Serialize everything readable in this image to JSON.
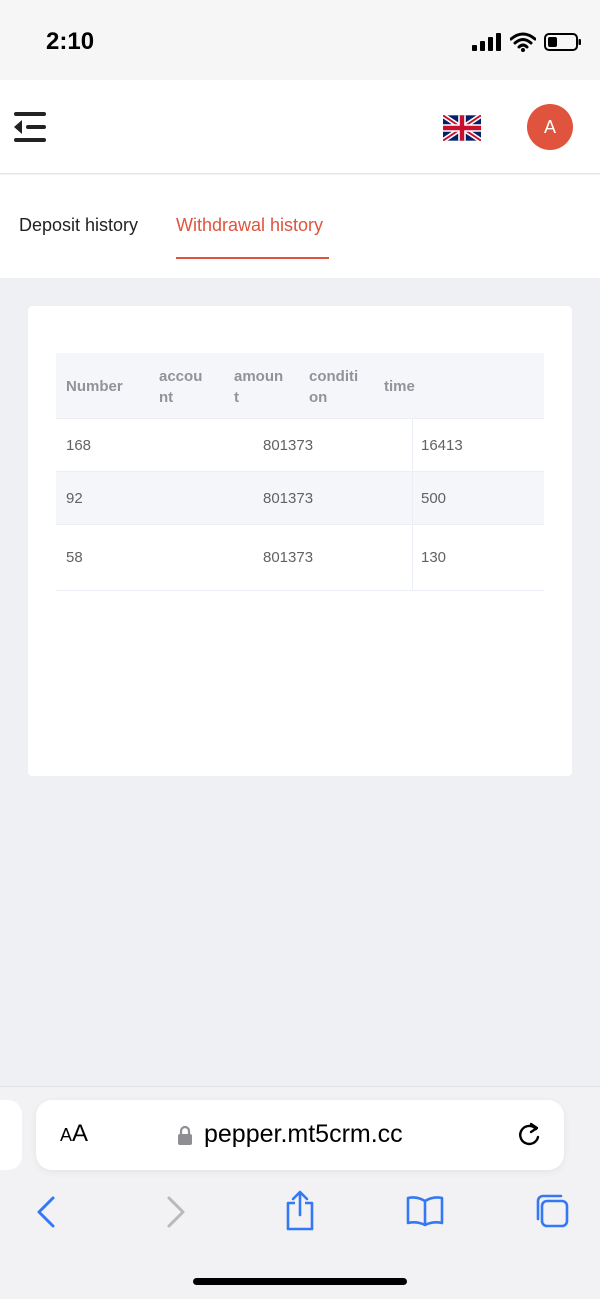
{
  "status_bar": {
    "time": "2:10"
  },
  "header": {
    "avatar_initial": "A",
    "language_flag": "uk-flag-icon"
  },
  "tabs": [
    {
      "label": "Deposit history",
      "active": false
    },
    {
      "label": "Withdrawal history",
      "active": true
    }
  ],
  "table": {
    "columns": [
      {
        "l1": "Number",
        "l2": ""
      },
      {
        "l1": "accou",
        "l2": "nt"
      },
      {
        "l1": "amoun",
        "l2": "t"
      },
      {
        "l1": "conditi",
        "l2": "on"
      },
      {
        "l1": "time",
        "l2": ""
      }
    ],
    "rows": [
      {
        "number": "168",
        "account": "801373",
        "amount": "16413"
      },
      {
        "number": "92",
        "account": "801373",
        "amount": "500"
      },
      {
        "number": "58",
        "account": "801373",
        "amount": "130"
      }
    ]
  },
  "browser": {
    "aa_label_big": "A",
    "aa_label_small": "A",
    "url": "pepper.mt5crm.cc"
  },
  "colors": {
    "accent": "#e0533d",
    "link_blue": "#3478f6"
  }
}
